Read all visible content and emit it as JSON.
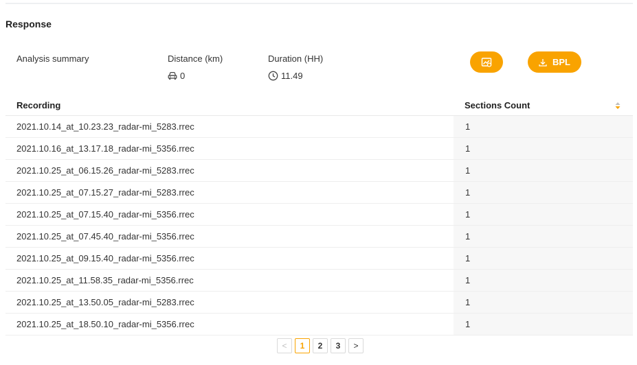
{
  "section": {
    "title": "Response"
  },
  "summary": {
    "label": "Analysis summary",
    "distance": {
      "label": "Distance (km)",
      "value": "0",
      "icon": "car-icon"
    },
    "duration": {
      "label": "Duration (HH)",
      "value": "11.49",
      "icon": "clock-icon"
    }
  },
  "buttons": {
    "chart": {
      "icon": "chart-image-icon"
    },
    "bpl": {
      "label": "BPL",
      "icon": "download-icon"
    }
  },
  "table": {
    "headers": {
      "recording": "Recording",
      "sections_count": "Sections Count"
    },
    "rows": [
      {
        "recording": "2021.10.14_at_10.23.23_radar-mi_5283.rrec",
        "count": "1"
      },
      {
        "recording": "2021.10.16_at_13.17.18_radar-mi_5356.rrec",
        "count": "1"
      },
      {
        "recording": "2021.10.25_at_06.15.26_radar-mi_5283.rrec",
        "count": "1"
      },
      {
        "recording": "2021.10.25_at_07.15.27_radar-mi_5283.rrec",
        "count": "1"
      },
      {
        "recording": "2021.10.25_at_07.15.40_radar-mi_5356.rrec",
        "count": "1"
      },
      {
        "recording": "2021.10.25_at_07.45.40_radar-mi_5356.rrec",
        "count": "1"
      },
      {
        "recording": "2021.10.25_at_09.15.40_radar-mi_5356.rrec",
        "count": "1"
      },
      {
        "recording": "2021.10.25_at_11.58.35_radar-mi_5356.rrec",
        "count": "1"
      },
      {
        "recording": "2021.10.25_at_13.50.05_radar-mi_5283.rrec",
        "count": "1"
      },
      {
        "recording": "2021.10.25_at_18.50.10_radar-mi_5356.rrec",
        "count": "1"
      }
    ]
  },
  "pagination": {
    "pages": [
      "1",
      "2",
      "3"
    ],
    "current": "1",
    "prev": "<",
    "next": ">"
  },
  "colors": {
    "accent": "#f9a300"
  }
}
